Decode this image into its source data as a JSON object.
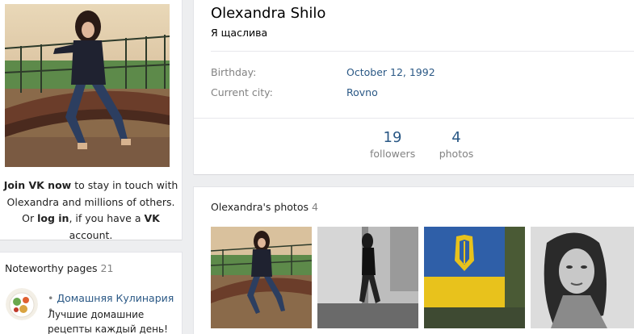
{
  "left": {
    "join": {
      "join_link": "Join VK now",
      "line1_rest": " to stay in touch with",
      "line2": "Olexandra and millions of others.",
      "or": "Or ",
      "login_link": "log in",
      "if_you_have": ", if you have a ",
      "vk": "VK",
      "account": " account."
    },
    "pages": {
      "title": "Noteworthy pages",
      "count": "21",
      "item": {
        "bullet": "•",
        "name": "Домашняя Кулинария",
        "description": "Лучшие домашние рецепты каждый день!"
      }
    }
  },
  "profile": {
    "name": "Olexandra Shilo",
    "status": "Я щаслива",
    "info": [
      {
        "label": "Birthday:",
        "value": "October 12, 1992"
      },
      {
        "label": "Current city:",
        "value": "Rovno"
      }
    ],
    "counters": [
      {
        "num": "19",
        "label": "followers"
      },
      {
        "num": "4",
        "label": "photos"
      }
    ]
  },
  "photos": {
    "title": "Olexandra's photos",
    "count": "4"
  },
  "colors": {
    "link": "#2a5885",
    "muted": "#828282",
    "background": "#edeef0"
  }
}
